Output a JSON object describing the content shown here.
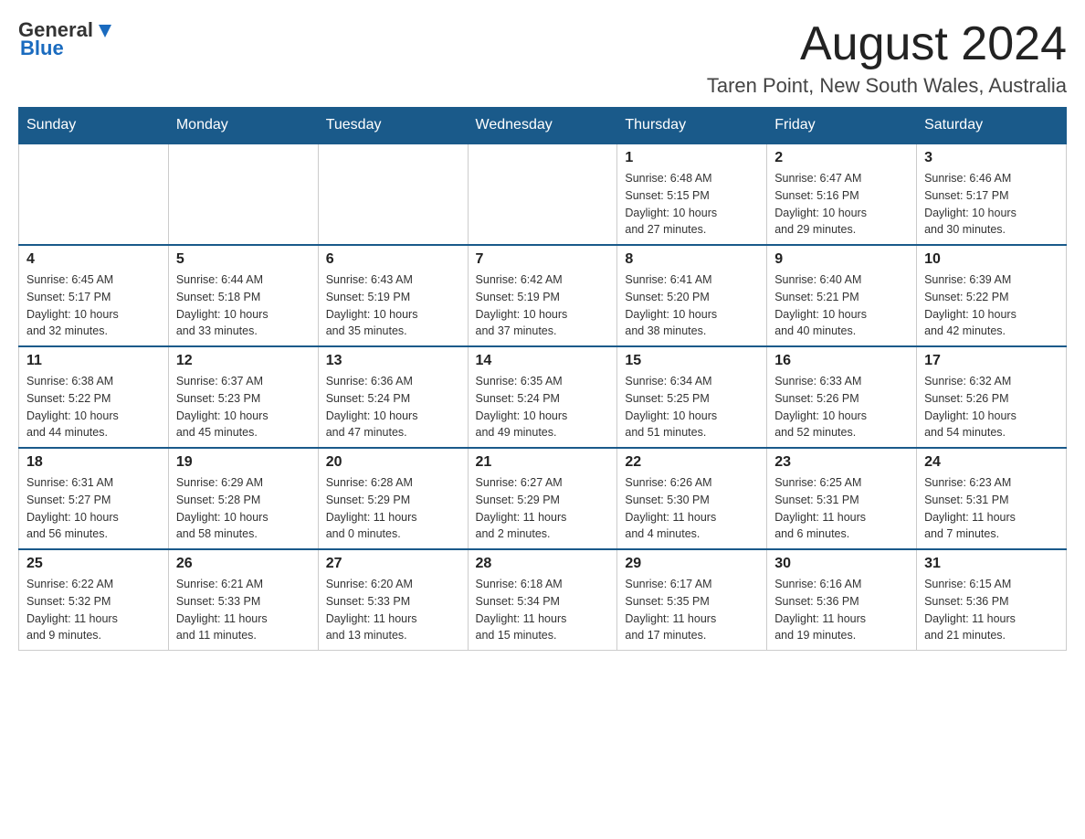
{
  "header": {
    "logo_general": "General",
    "logo_blue": "Blue",
    "month": "August 2024",
    "location": "Taren Point, New South Wales, Australia"
  },
  "weekdays": [
    "Sunday",
    "Monday",
    "Tuesday",
    "Wednesday",
    "Thursday",
    "Friday",
    "Saturday"
  ],
  "weeks": [
    [
      {
        "day": "",
        "info": ""
      },
      {
        "day": "",
        "info": ""
      },
      {
        "day": "",
        "info": ""
      },
      {
        "day": "",
        "info": ""
      },
      {
        "day": "1",
        "info": "Sunrise: 6:48 AM\nSunset: 5:15 PM\nDaylight: 10 hours\nand 27 minutes."
      },
      {
        "day": "2",
        "info": "Sunrise: 6:47 AM\nSunset: 5:16 PM\nDaylight: 10 hours\nand 29 minutes."
      },
      {
        "day": "3",
        "info": "Sunrise: 6:46 AM\nSunset: 5:17 PM\nDaylight: 10 hours\nand 30 minutes."
      }
    ],
    [
      {
        "day": "4",
        "info": "Sunrise: 6:45 AM\nSunset: 5:17 PM\nDaylight: 10 hours\nand 32 minutes."
      },
      {
        "day": "5",
        "info": "Sunrise: 6:44 AM\nSunset: 5:18 PM\nDaylight: 10 hours\nand 33 minutes."
      },
      {
        "day": "6",
        "info": "Sunrise: 6:43 AM\nSunset: 5:19 PM\nDaylight: 10 hours\nand 35 minutes."
      },
      {
        "day": "7",
        "info": "Sunrise: 6:42 AM\nSunset: 5:19 PM\nDaylight: 10 hours\nand 37 minutes."
      },
      {
        "day": "8",
        "info": "Sunrise: 6:41 AM\nSunset: 5:20 PM\nDaylight: 10 hours\nand 38 minutes."
      },
      {
        "day": "9",
        "info": "Sunrise: 6:40 AM\nSunset: 5:21 PM\nDaylight: 10 hours\nand 40 minutes."
      },
      {
        "day": "10",
        "info": "Sunrise: 6:39 AM\nSunset: 5:22 PM\nDaylight: 10 hours\nand 42 minutes."
      }
    ],
    [
      {
        "day": "11",
        "info": "Sunrise: 6:38 AM\nSunset: 5:22 PM\nDaylight: 10 hours\nand 44 minutes."
      },
      {
        "day": "12",
        "info": "Sunrise: 6:37 AM\nSunset: 5:23 PM\nDaylight: 10 hours\nand 45 minutes."
      },
      {
        "day": "13",
        "info": "Sunrise: 6:36 AM\nSunset: 5:24 PM\nDaylight: 10 hours\nand 47 minutes."
      },
      {
        "day": "14",
        "info": "Sunrise: 6:35 AM\nSunset: 5:24 PM\nDaylight: 10 hours\nand 49 minutes."
      },
      {
        "day": "15",
        "info": "Sunrise: 6:34 AM\nSunset: 5:25 PM\nDaylight: 10 hours\nand 51 minutes."
      },
      {
        "day": "16",
        "info": "Sunrise: 6:33 AM\nSunset: 5:26 PM\nDaylight: 10 hours\nand 52 minutes."
      },
      {
        "day": "17",
        "info": "Sunrise: 6:32 AM\nSunset: 5:26 PM\nDaylight: 10 hours\nand 54 minutes."
      }
    ],
    [
      {
        "day": "18",
        "info": "Sunrise: 6:31 AM\nSunset: 5:27 PM\nDaylight: 10 hours\nand 56 minutes."
      },
      {
        "day": "19",
        "info": "Sunrise: 6:29 AM\nSunset: 5:28 PM\nDaylight: 10 hours\nand 58 minutes."
      },
      {
        "day": "20",
        "info": "Sunrise: 6:28 AM\nSunset: 5:29 PM\nDaylight: 11 hours\nand 0 minutes."
      },
      {
        "day": "21",
        "info": "Sunrise: 6:27 AM\nSunset: 5:29 PM\nDaylight: 11 hours\nand 2 minutes."
      },
      {
        "day": "22",
        "info": "Sunrise: 6:26 AM\nSunset: 5:30 PM\nDaylight: 11 hours\nand 4 minutes."
      },
      {
        "day": "23",
        "info": "Sunrise: 6:25 AM\nSunset: 5:31 PM\nDaylight: 11 hours\nand 6 minutes."
      },
      {
        "day": "24",
        "info": "Sunrise: 6:23 AM\nSunset: 5:31 PM\nDaylight: 11 hours\nand 7 minutes."
      }
    ],
    [
      {
        "day": "25",
        "info": "Sunrise: 6:22 AM\nSunset: 5:32 PM\nDaylight: 11 hours\nand 9 minutes."
      },
      {
        "day": "26",
        "info": "Sunrise: 6:21 AM\nSunset: 5:33 PM\nDaylight: 11 hours\nand 11 minutes."
      },
      {
        "day": "27",
        "info": "Sunrise: 6:20 AM\nSunset: 5:33 PM\nDaylight: 11 hours\nand 13 minutes."
      },
      {
        "day": "28",
        "info": "Sunrise: 6:18 AM\nSunset: 5:34 PM\nDaylight: 11 hours\nand 15 minutes."
      },
      {
        "day": "29",
        "info": "Sunrise: 6:17 AM\nSunset: 5:35 PM\nDaylight: 11 hours\nand 17 minutes."
      },
      {
        "day": "30",
        "info": "Sunrise: 6:16 AM\nSunset: 5:36 PM\nDaylight: 11 hours\nand 19 minutes."
      },
      {
        "day": "31",
        "info": "Sunrise: 6:15 AM\nSunset: 5:36 PM\nDaylight: 11 hours\nand 21 minutes."
      }
    ]
  ]
}
